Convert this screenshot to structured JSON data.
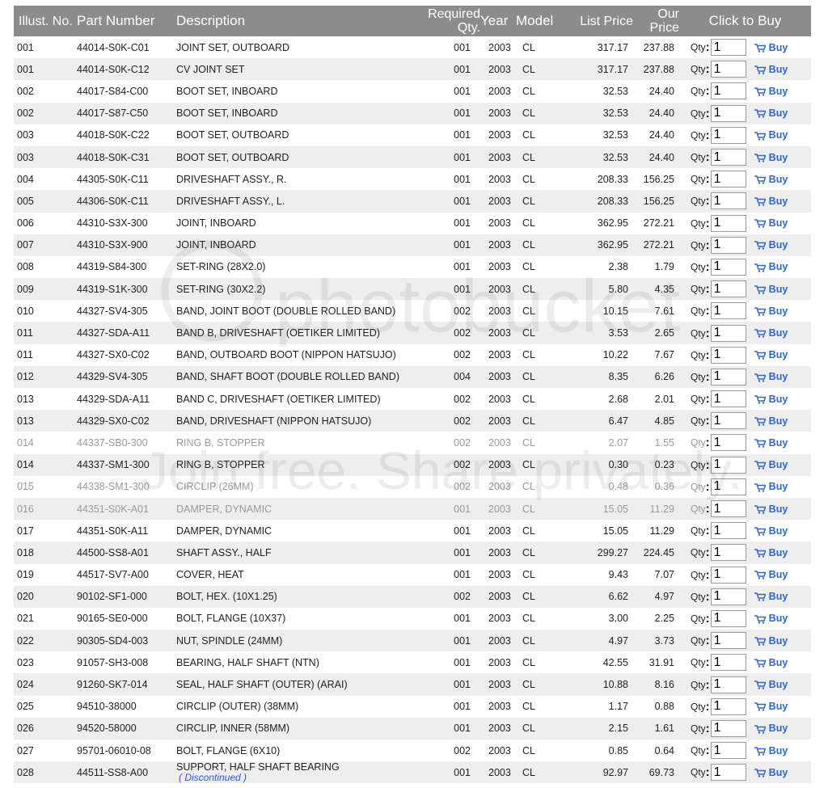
{
  "headers": {
    "illus": "Illust. No.",
    "part": "Part Number",
    "desc": "Description",
    "req": "Required Qty.",
    "year": "Year",
    "model": "Model",
    "list": "List Price",
    "our": "Our Price",
    "buy": "Click to Buy"
  },
  "buy_row": {
    "qty_label": "Qty",
    "qty_colon": ":",
    "buy_label": "Buy"
  },
  "rows": [
    {
      "illus": "001",
      "part": "44014-S0K-C01",
      "desc": "JOINT SET, OUTBOARD",
      "req": "001",
      "year": "2003",
      "model": "CL",
      "list": "317.17",
      "our": "237.88",
      "qty": "1",
      "dim": false
    },
    {
      "illus": "001",
      "part": "44014-S0K-C12",
      "desc": "CV JOINT SET",
      "req": "001",
      "year": "2003",
      "model": "CL",
      "list": "317.17",
      "our": "237.88",
      "qty": "1",
      "dim": false
    },
    {
      "illus": "002",
      "part": "44017-S84-C00",
      "desc": "BOOT SET, INBOARD",
      "req": "001",
      "year": "2003",
      "model": "CL",
      "list": "32.53",
      "our": "24.40",
      "qty": "1",
      "dim": false
    },
    {
      "illus": "002",
      "part": "44017-S87-C50",
      "desc": "BOOT SET, INBOARD",
      "req": "001",
      "year": "2003",
      "model": "CL",
      "list": "32.53",
      "our": "24.40",
      "qty": "1",
      "dim": false
    },
    {
      "illus": "003",
      "part": "44018-S0K-C22",
      "desc": "BOOT SET, OUTBOARD",
      "req": "001",
      "year": "2003",
      "model": "CL",
      "list": "32.53",
      "our": "24.40",
      "qty": "1",
      "dim": false
    },
    {
      "illus": "003",
      "part": "44018-S0K-C31",
      "desc": "BOOT SET, OUTBOARD",
      "req": "001",
      "year": "2003",
      "model": "CL",
      "list": "32.53",
      "our": "24.40",
      "qty": "1",
      "dim": false
    },
    {
      "illus": "004",
      "part": "44305-S0K-C11",
      "desc": "DRIVESHAFT ASSY., R.",
      "req": "001",
      "year": "2003",
      "model": "CL",
      "list": "208.33",
      "our": "156.25",
      "qty": "1",
      "dim": false
    },
    {
      "illus": "005",
      "part": "44306-S0K-C11",
      "desc": "DRIVESHAFT ASSY., L.",
      "req": "001",
      "year": "2003",
      "model": "CL",
      "list": "208.33",
      "our": "156.25",
      "qty": "1",
      "dim": false
    },
    {
      "illus": "006",
      "part": "44310-S3X-300",
      "desc": "JOINT, INBOARD",
      "req": "001",
      "year": "2003",
      "model": "CL",
      "list": "362.95",
      "our": "272.21",
      "qty": "1",
      "dim": false
    },
    {
      "illus": "007",
      "part": "44310-S3X-900",
      "desc": "JOINT, INBOARD",
      "req": "001",
      "year": "2003",
      "model": "CL",
      "list": "362.95",
      "our": "272.21",
      "qty": "1",
      "dim": false
    },
    {
      "illus": "008",
      "part": "44319-S84-300",
      "desc": "SET-RING (28X2.0)",
      "req": "001",
      "year": "2003",
      "model": "CL",
      "list": "2.38",
      "our": "1.79",
      "qty": "1",
      "dim": false
    },
    {
      "illus": "009",
      "part": "44319-S1K-300",
      "desc": "SET-RING (30X2.2)",
      "req": "001",
      "year": "2003",
      "model": "CL",
      "list": "5.80",
      "our": "4.35",
      "qty": "1",
      "dim": false
    },
    {
      "illus": "010",
      "part": "44327-SV4-305",
      "desc": "BAND, JOINT BOOT (DOUBLE ROLLED BAND)",
      "req": "002",
      "year": "2003",
      "model": "CL",
      "list": "10.15",
      "our": "7.61",
      "qty": "1",
      "dim": false
    },
    {
      "illus": "011",
      "part": "44327-SDA-A11",
      "desc": "BAND B, DRIVESHAFT (OETIKER LIMITED)",
      "req": "002",
      "year": "2003",
      "model": "CL",
      "list": "3.53",
      "our": "2.65",
      "qty": "1",
      "dim": false
    },
    {
      "illus": "011",
      "part": "44327-SX0-C02",
      "desc": "BAND, OUTBOARD BOOT (NIPPON HATSUJO)",
      "req": "002",
      "year": "2003",
      "model": "CL",
      "list": "10.22",
      "our": "7.67",
      "qty": "1",
      "dim": false
    },
    {
      "illus": "012",
      "part": "44329-SV4-305",
      "desc": "BAND, SHAFT BOOT (DOUBLE ROLLED BAND)",
      "req": "004",
      "year": "2003",
      "model": "CL",
      "list": "8.35",
      "our": "6.26",
      "qty": "1",
      "dim": false
    },
    {
      "illus": "013",
      "part": "44329-SDA-A11",
      "desc": "BAND C, DRIVESHAFT (OETIKER LIMITED)",
      "req": "002",
      "year": "2003",
      "model": "CL",
      "list": "2.68",
      "our": "2.01",
      "qty": "1",
      "dim": false
    },
    {
      "illus": "013",
      "part": "44329-SX0-C02",
      "desc": "BAND, DRIVESHAFT (NIPPON HATSUJO)",
      "req": "002",
      "year": "2003",
      "model": "CL",
      "list": "6.47",
      "our": "4.85",
      "qty": "1",
      "dim": false
    },
    {
      "illus": "014",
      "part": "44337-SB0-300",
      "desc": "RING B, STOPPER",
      "req": "002",
      "year": "2003",
      "model": "CL",
      "list": "2.07",
      "our": "1.55",
      "qty": "1",
      "dim": true
    },
    {
      "illus": "014",
      "part": "44337-SM1-300",
      "desc": "RING B, STOPPER",
      "req": "002",
      "year": "2003",
      "model": "CL",
      "list": "0.30",
      "our": "0.23",
      "qty": "1",
      "dim": false
    },
    {
      "illus": "015",
      "part": "44338-SM1-300",
      "desc": "CIRCLIP (26MM)",
      "req": "002",
      "year": "2003",
      "model": "CL",
      "list": "0.48",
      "our": "0.36",
      "qty": "1",
      "dim": true
    },
    {
      "illus": "016",
      "part": "44351-S0K-A01",
      "desc": "DAMPER, DYNAMIC",
      "req": "001",
      "year": "2003",
      "model": "CL",
      "list": "15.05",
      "our": "11.29",
      "qty": "1",
      "dim": true
    },
    {
      "illus": "017",
      "part": "44351-S0K-A11",
      "desc": "DAMPER, DYNAMIC",
      "req": "001",
      "year": "2003",
      "model": "CL",
      "list": "15.05",
      "our": "11.29",
      "qty": "1",
      "dim": false
    },
    {
      "illus": "018",
      "part": "44500-SS8-A01",
      "desc": "SHAFT ASSY., HALF",
      "req": "001",
      "year": "2003",
      "model": "CL",
      "list": "299.27",
      "our": "224.45",
      "qty": "1",
      "dim": false
    },
    {
      "illus": "019",
      "part": "44517-SV7-A00",
      "desc": "COVER, HEAT",
      "req": "001",
      "year": "2003",
      "model": "CL",
      "list": "9.43",
      "our": "7.07",
      "qty": "1",
      "dim": false
    },
    {
      "illus": "020",
      "part": "90102-SF1-000",
      "desc": "BOLT, HEX. (10X1.25)",
      "req": "002",
      "year": "2003",
      "model": "CL",
      "list": "6.62",
      "our": "4.97",
      "qty": "1",
      "dim": false
    },
    {
      "illus": "021",
      "part": "90165-SE0-000",
      "desc": "BOLT, FLANGE (10X37)",
      "req": "001",
      "year": "2003",
      "model": "CL",
      "list": "3.00",
      "our": "2.25",
      "qty": "1",
      "dim": false
    },
    {
      "illus": "022",
      "part": "90305-SD4-003",
      "desc": "NUT, SPINDLE (24MM)",
      "req": "001",
      "year": "2003",
      "model": "CL",
      "list": "4.97",
      "our": "3.73",
      "qty": "1",
      "dim": false
    },
    {
      "illus": "023",
      "part": "91057-SH3-008",
      "desc": "BEARING, HALF SHAFT (NTN)",
      "req": "001",
      "year": "2003",
      "model": "CL",
      "list": "42.55",
      "our": "31.91",
      "qty": "1",
      "dim": false
    },
    {
      "illus": "024",
      "part": "91260-SK7-014",
      "desc": "SEAL, HALF SHAFT (OUTER) (ARAI)",
      "req": "001",
      "year": "2003",
      "model": "CL",
      "list": "10.88",
      "our": "8.16",
      "qty": "1",
      "dim": false
    },
    {
      "illus": "025",
      "part": "94510-38000",
      "desc": "CIRCLIP (OUTER) (38MM)",
      "req": "001",
      "year": "2003",
      "model": "CL",
      "list": "1.17",
      "our": "0.88",
      "qty": "1",
      "dim": false
    },
    {
      "illus": "026",
      "part": "94520-58000",
      "desc": "CIRCLIP, INNER (58MM)",
      "req": "001",
      "year": "2003",
      "model": "CL",
      "list": "2.15",
      "our": "1.61",
      "qty": "1",
      "dim": false
    },
    {
      "illus": "027",
      "part": "95701-06010-08",
      "desc": "BOLT, FLANGE (6X10)",
      "req": "002",
      "year": "2003",
      "model": "CL",
      "list": "0.85",
      "our": "0.64",
      "qty": "1",
      "dim": false
    },
    {
      "illus": "028",
      "part": "44511-SS8-A00",
      "desc": "SUPPORT, HALF SHAFT BEARING",
      "note": "( Discontinued )",
      "req": "001",
      "year": "2003",
      "model": "CL",
      "list": "92.97",
      "our": "69.73",
      "qty": "1",
      "dim": false
    }
  ],
  "watermark": {
    "line1": "photobucket",
    "line2": "Join free. Share privately."
  },
  "colors": {
    "header_bg": "#8c8c8c",
    "row_alt": "#eeeeee",
    "link": "#3366cc"
  }
}
